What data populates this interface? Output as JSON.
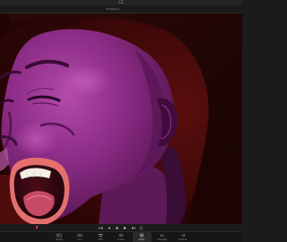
{
  "app": {
    "title": "C1"
  },
  "viewer": {
    "zoom": "",
    "timeline_name": "Timeline 1",
    "timecode": "",
    "image": "close-up of a woman screaming with eyes shut, purple/magenta color grade over dark red background"
  },
  "transport": {
    "controls": [
      "skip-to-start-icon",
      "step-back-icon",
      "stop-icon",
      "play-icon",
      "step-forward-icon",
      "loop-icon"
    ]
  },
  "pages": {
    "active": "Color",
    "tabs": [
      {
        "label": "Media",
        "icon": "media-icon"
      },
      {
        "label": "Cut",
        "icon": "cut-icon"
      },
      {
        "label": "Edit",
        "icon": "edit-icon"
      },
      {
        "label": "Fusion",
        "icon": "fusion-icon"
      },
      {
        "label": "Color",
        "icon": "color-icon"
      },
      {
        "label": "Fairlight",
        "icon": "fairlight-icon"
      },
      {
        "label": "Deliver",
        "icon": "deliver-icon"
      }
    ]
  },
  "colors": {
    "accent": "#e23b3b",
    "grade_magenta": "#8d2a8a",
    "background_red": "#4a0a0a"
  }
}
